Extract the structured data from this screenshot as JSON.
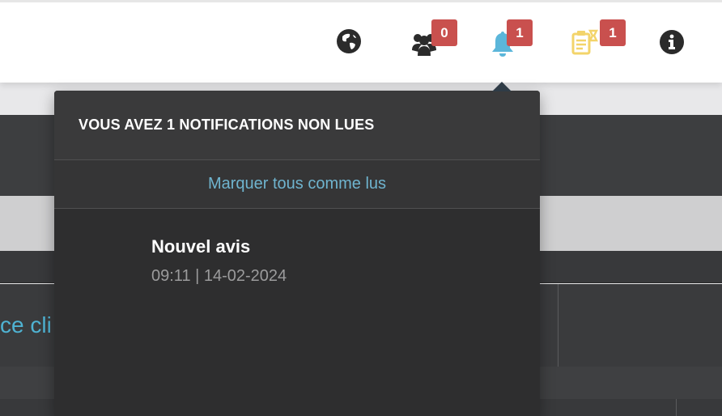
{
  "header": {
    "icons": [
      {
        "name": "globe-icon"
      },
      {
        "name": "users-icon",
        "badge": "0"
      },
      {
        "name": "bell-icon",
        "badge": "1"
      },
      {
        "name": "tasks-icon",
        "badge": "1"
      },
      {
        "name": "info-icon"
      }
    ],
    "colors": {
      "bell": "#5bb6da",
      "tasks": "#f3d46a",
      "badge": "#c9504e"
    }
  },
  "background": {
    "partial_link": "ce cli"
  },
  "notifications": {
    "heading": "VOUS AVEZ 1 NOTIFICATIONS NON LUES",
    "mark_all_read": "Marquer tous comme lus",
    "items": [
      {
        "title": "Nouvel avis",
        "time": "09:11 | 14-02-2024"
      }
    ]
  }
}
